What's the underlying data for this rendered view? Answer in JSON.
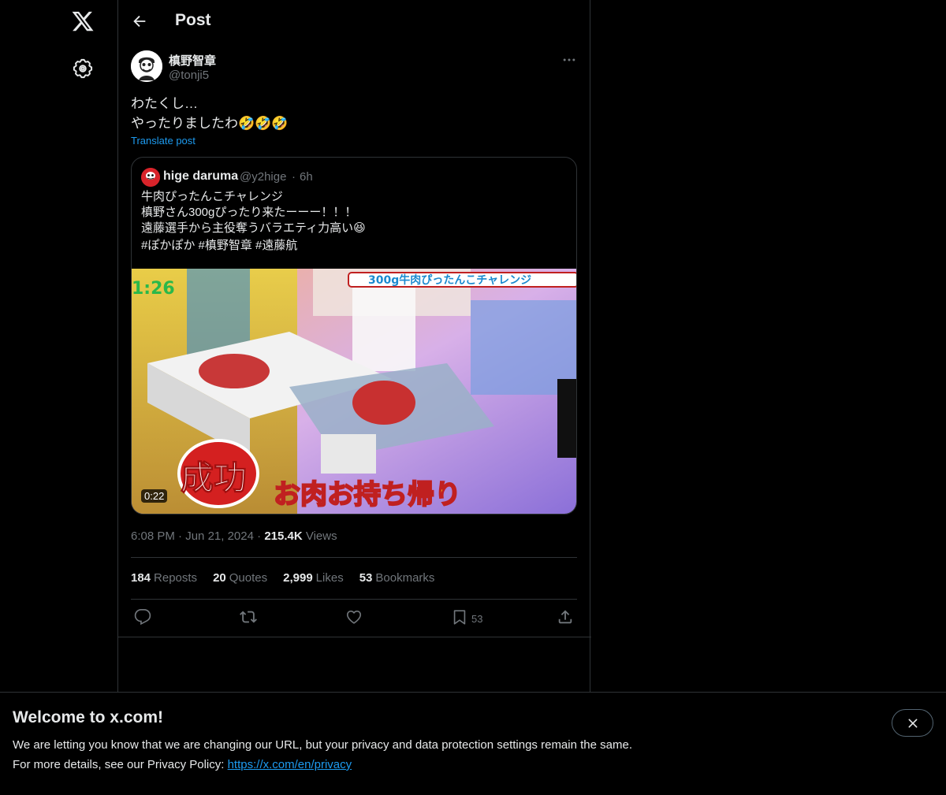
{
  "nav": {
    "logo_icon": "x-logo-icon",
    "settings_icon": "gear-icon"
  },
  "header": {
    "title": "Post"
  },
  "tweet": {
    "author_name": "槙野智章",
    "author_handle": "@tonji5",
    "text": "わたくし…\nやったりましたわ🤣🤣🤣",
    "translate_label": "Translate post",
    "time": "6:08 PM",
    "date": "Jun 21, 2024",
    "views_count": "215.4K",
    "views_label": "Views"
  },
  "quote": {
    "author_name": "hige daruma",
    "author_handle": "@y2hige",
    "separator": "·",
    "age": "6h",
    "text": "牛肉ぴったんこチャレンジ\n槙野さん300gぴったり来たーーー！！！\n遠藤選手から主役奪うバラエティ力高い😆",
    "hashtags": "#ぽかぽか #槙野智章 #遠藤航",
    "video": {
      "duration": "0:22",
      "overlay_top": "300g牛肉ぴったんこチャレンジ",
      "overlay_timer": "1:26",
      "overlay_success": "成功",
      "overlay_caption": "お肉お持ち帰り"
    }
  },
  "meta_separator": "·",
  "stats": [
    {
      "count": "184",
      "label": "Reposts"
    },
    {
      "count": "20",
      "label": "Quotes"
    },
    {
      "count": "2,999",
      "label": "Likes"
    },
    {
      "count": "53",
      "label": "Bookmarks"
    }
  ],
  "actions": {
    "bookmark_count": "53"
  },
  "banner": {
    "title": "Welcome to x.com!",
    "line1": "We are letting you know that we are changing our URL, but your privacy and data protection settings remain the same.",
    "line2_prefix": "For more details, see our Privacy Policy: ",
    "link": "https://x.com/en/privacy"
  },
  "colors": {
    "accent": "#1d9bf0",
    "background": "#000000",
    "text": "#e7e9ea",
    "muted": "#71767b",
    "border": "#2f3336"
  }
}
